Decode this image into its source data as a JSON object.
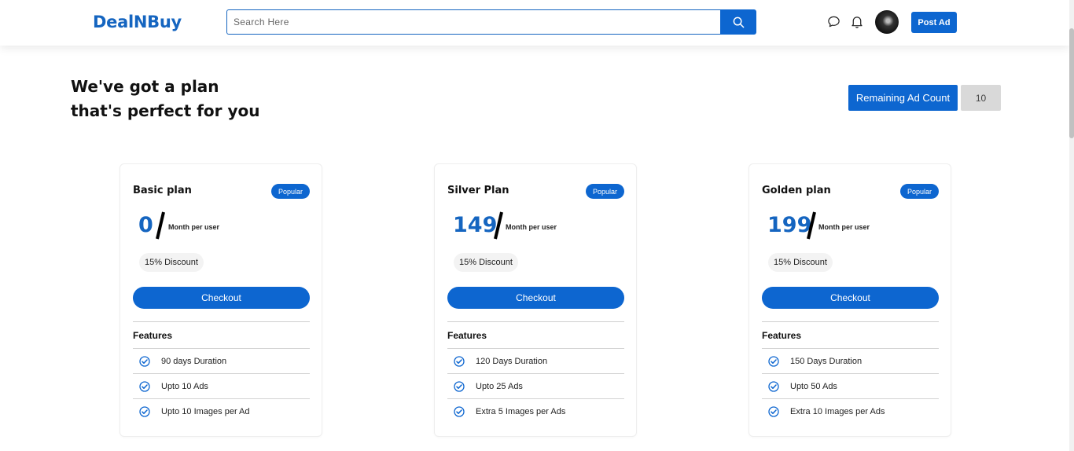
{
  "header": {
    "logo": "DealNBuy",
    "search_placeholder": "Search Here",
    "post_ad_label": "Post Ad"
  },
  "colors": {
    "brand": "#0d66d0",
    "accent_text": "#1565c0",
    "count_bg": "#d9d9d9"
  },
  "hero": {
    "line1": "We've got a plan",
    "line2": "that's perfect for you"
  },
  "remaining": {
    "label": "Remaining Ad Count",
    "value": "10"
  },
  "plans": [
    {
      "name": "Basic plan",
      "badge": "Popular",
      "price": "0",
      "period": "Month per user",
      "discount": "15% Discount",
      "checkout": "Checkout",
      "features_title": "Features",
      "features": [
        "90 days Duration",
        "Upto 10 Ads",
        "Upto 10 Images per Ad"
      ]
    },
    {
      "name": "Silver Plan",
      "badge": "Popular",
      "price": "149",
      "period": "Month per user",
      "discount": "15% Discount",
      "checkout": "Checkout",
      "features_title": "Features",
      "features": [
        "120 Days Duration",
        "Upto 25 Ads",
        "Extra 5 Images per Ads"
      ]
    },
    {
      "name": "Golden plan",
      "badge": "Popular",
      "price": "199",
      "period": "Month per user",
      "discount": "15% Discount",
      "checkout": "Checkout",
      "features_title": "Features",
      "features": [
        "150 Days Duration",
        "Upto 50 Ads",
        "Extra 10 Images per Ads"
      ]
    }
  ]
}
